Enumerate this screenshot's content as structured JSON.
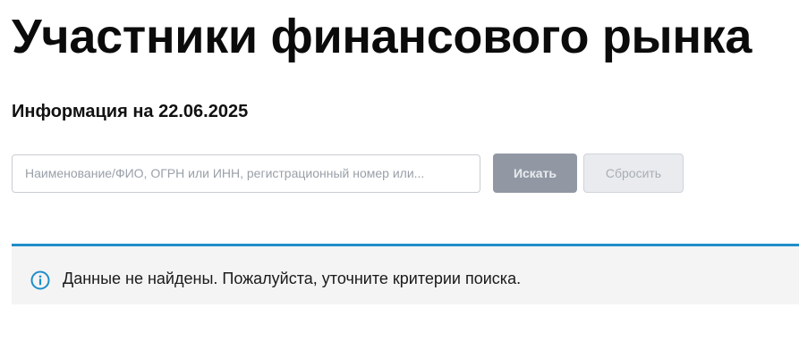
{
  "page": {
    "title": "Участники финансового рынка",
    "info_date": "Информация на 22.06.2025"
  },
  "search": {
    "placeholder": "Наименование/ФИО, ОГРН или ИНН, регистрационный номер или...",
    "value": "",
    "search_button_label": "Искать",
    "reset_button_label": "Сбросить"
  },
  "notice": {
    "icon": "info-circle-icon",
    "message": "Данные не найдены. Пожалуйста, уточните критерии поиска.",
    "accent_color": "#1f8ec9"
  },
  "colors": {
    "search_button_bg": "#9198a3",
    "reset_button_bg": "#e9ebee",
    "notice_bg": "#f4f4f4"
  }
}
